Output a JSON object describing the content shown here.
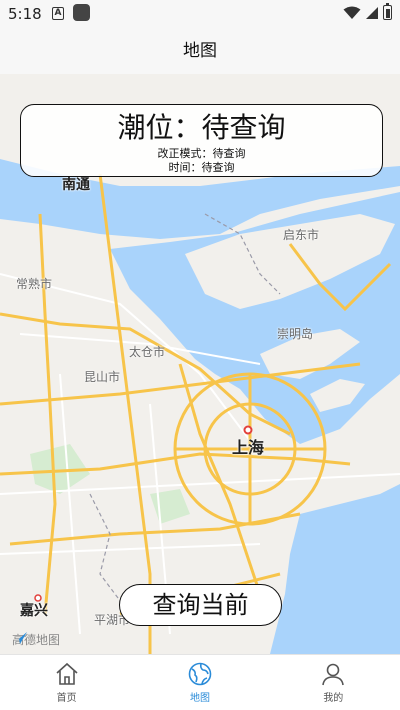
{
  "status_bar": {
    "time": "5:18",
    "icon_a": "A"
  },
  "header": {
    "title": "地图"
  },
  "map": {
    "labels": {
      "nantong": "南通",
      "qidong": "启东市",
      "changshu": "常熟市",
      "chongming": "崇明岛",
      "taicang": "太仓市",
      "kunshan": "昆山市",
      "shanghai": "上海",
      "jiaxing": "嘉兴",
      "pinghu": "平湖市"
    },
    "logo": "高德地图"
  },
  "tide_panel": {
    "title": "潮位：待查询",
    "mode": "改正模式：待查询",
    "time": "时间：待查询"
  },
  "query_button": {
    "label": "查询当前"
  },
  "tabs": [
    {
      "label": "首页"
    },
    {
      "label": "地图"
    },
    {
      "label": "我的"
    }
  ],
  "colors": {
    "water": "#a9d3fb",
    "road": "#f7c44a",
    "active_tab": "#2a8bd8"
  }
}
